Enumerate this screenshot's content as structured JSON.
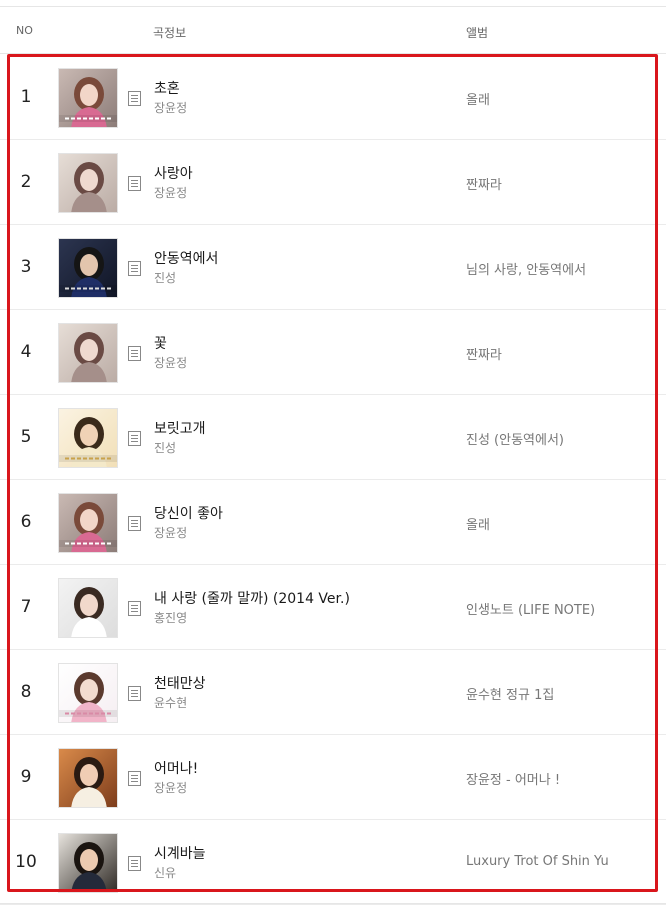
{
  "header": {
    "no": "NO",
    "song_info": "곡정보",
    "album": "앨범"
  },
  "songs": [
    {
      "rank": "1",
      "title": "초혼",
      "artist": "장윤정",
      "album": "올래",
      "art": "pink"
    },
    {
      "rank": "2",
      "title": "사랑아",
      "artist": "장윤정",
      "album": "짠짜라",
      "art": "soft"
    },
    {
      "rank": "3",
      "title": "안동역에서",
      "artist": "진성",
      "album": "님의 사랑, 안동역에서",
      "art": "navy"
    },
    {
      "rank": "4",
      "title": "꽃",
      "artist": "장윤정",
      "album": "짠짜라",
      "art": "soft"
    },
    {
      "rank": "5",
      "title": "보릿고개",
      "artist": "진성",
      "album": "진성 (안동역에서)",
      "art": "cream"
    },
    {
      "rank": "6",
      "title": "당신이 좋아",
      "artist": "장윤정",
      "album": "올래",
      "art": "pink"
    },
    {
      "rank": "7",
      "title": "내 사랑 (줄까 말까) (2014 Ver.)",
      "artist": "홍진영",
      "album": "인생노트 (LIFE NOTE)",
      "art": "white"
    },
    {
      "rank": "8",
      "title": "천태만상",
      "artist": "윤수현",
      "album": "윤수현 정규 1집",
      "art": "pale"
    },
    {
      "rank": "9",
      "title": "어머나!",
      "artist": "장윤정",
      "album": "장윤정 - 어머나 !",
      "art": "warm"
    },
    {
      "rank": "10",
      "title": "시계바늘",
      "artist": "신유",
      "album": "Luxury Trot Of Shin Yu",
      "art": "dark"
    }
  ],
  "colors": {
    "highlight": "#d9161c"
  },
  "icons": {
    "lyrics": "document-lines-icon"
  }
}
